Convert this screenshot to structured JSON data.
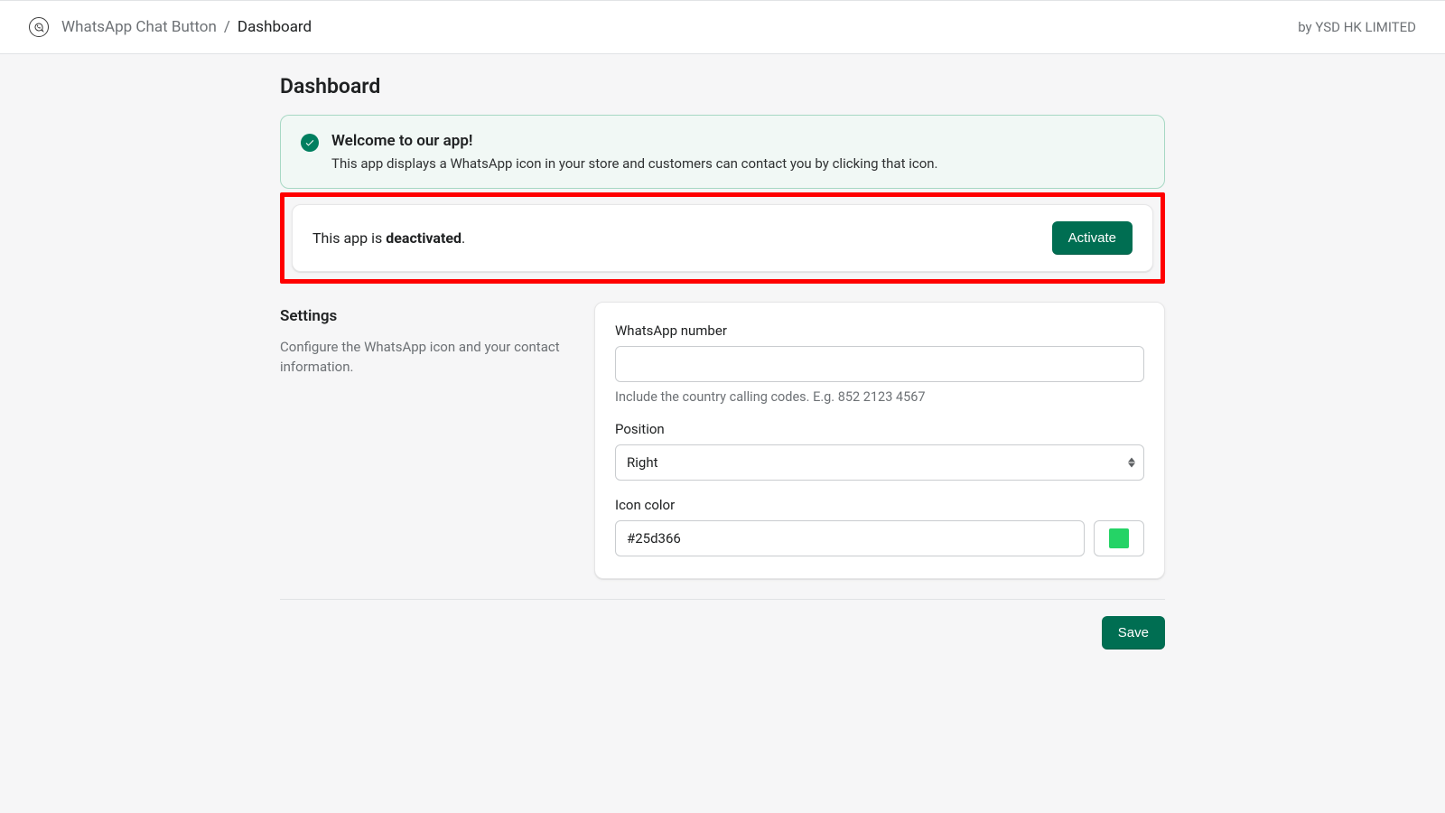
{
  "header": {
    "app_name": "WhatsApp Chat Button",
    "separator": "/",
    "crumb_current": "Dashboard",
    "byline": "by YSD HK LIMITED"
  },
  "page": {
    "title": "Dashboard"
  },
  "welcome": {
    "title": "Welcome to our app!",
    "desc": "This app displays a WhatsApp icon in your store and customers can contact you by clicking that icon."
  },
  "status": {
    "prefix": "This app is ",
    "state": "deactivated",
    "suffix": ".",
    "activate_label": "Activate"
  },
  "settings": {
    "heading": "Settings",
    "desc": "Configure the WhatsApp icon and your contact information.",
    "whatsapp": {
      "label": "WhatsApp number",
      "value": "",
      "helper": "Include the country calling codes. E.g. 852 2123 4567"
    },
    "position": {
      "label": "Position",
      "selected": "Right"
    },
    "icon_color": {
      "label": "Icon color",
      "value": "#25d366",
      "swatch": "#25d366"
    }
  },
  "footer": {
    "save_label": "Save"
  }
}
